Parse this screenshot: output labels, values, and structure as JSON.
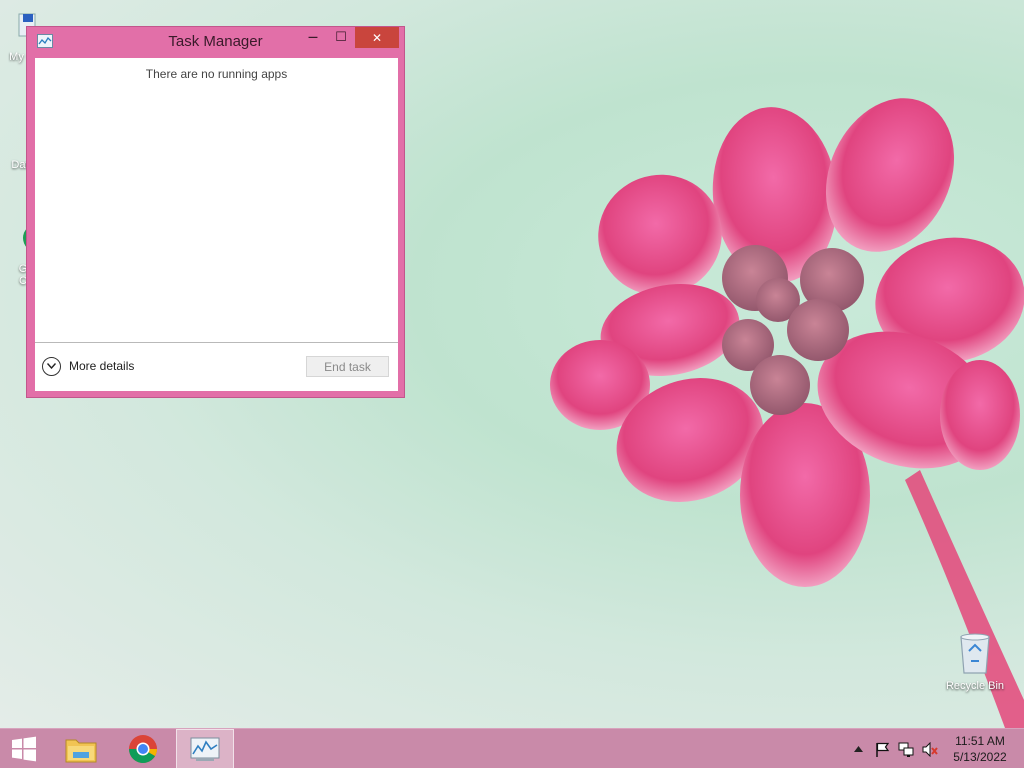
{
  "desktop": {
    "icons": [
      {
        "label": "My C"
      },
      {
        "label": "Data"
      },
      {
        "label": "G"
      },
      {
        "label": "C"
      }
    ],
    "recycle_bin_label": "Recycle Bin"
  },
  "task_manager": {
    "title": "Task Manager",
    "message": "There are no running apps",
    "more_details_label": "More details",
    "end_task_label": "End task",
    "minimize_glyph": "—",
    "maximize_glyph": "☐",
    "close_glyph": "✕"
  },
  "taskbar": {
    "items": [
      "start-button",
      "file-explorer",
      "chrome",
      "task-manager"
    ]
  },
  "tray": {
    "time": "11:51 AM",
    "date": "5/13/2022"
  },
  "colors": {
    "window_frame": "#e26fa8",
    "taskbar": "#c98aa9",
    "close_button": "#c9453d"
  }
}
